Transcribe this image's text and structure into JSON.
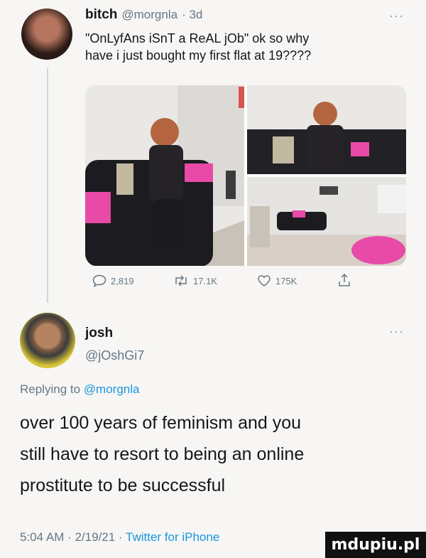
{
  "original_tweet": {
    "display_name": "bitch",
    "handle": "@morgnla",
    "time": "· 3d",
    "more": "···",
    "text_line1": "\"OnLyfAns iSnT a ReAL jOb\" ok so why",
    "text_line2": "have i just bought my first flat at 19????",
    "actions": {
      "replies": "2,819",
      "retweets": "17.1K",
      "likes": "175K"
    }
  },
  "reply": {
    "display_name": "josh",
    "handle": "@jOshGi7",
    "more": "···",
    "replying_prefix": "Replying to",
    "replying_to": "@morgnla",
    "text_line1": "over 100 years of feminism and you",
    "text_line2": "still have to resort to being an online",
    "text_line3": "prostitute to be successful",
    "timestamp": "5:04 AM · 2/19/21 · ",
    "source": "Twitter for iPhone"
  },
  "watermark": "mdupiu.pl",
  "colors": {
    "link": "#1b95e0",
    "muted": "#657786",
    "sofa": "#1c1c20",
    "pink": "#e84aa7"
  }
}
